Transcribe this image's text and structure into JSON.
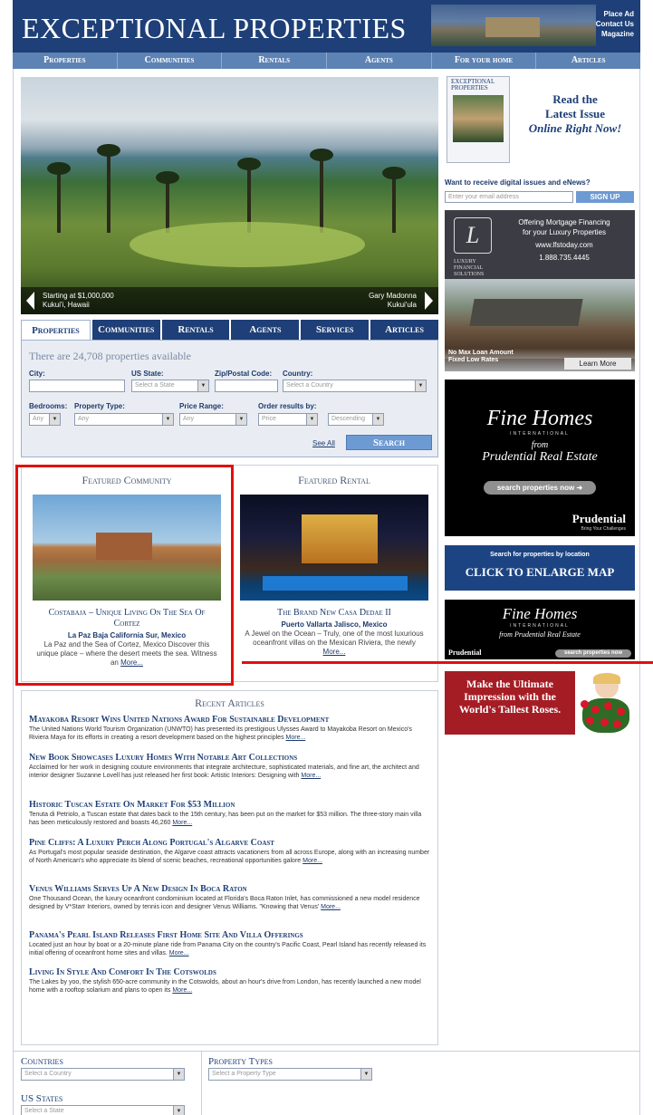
{
  "header": {
    "logo": "EXCEPTIONAL PROPERTIES",
    "links": [
      "Place Ad",
      "Contact Us",
      "Magazine"
    ]
  },
  "topnav": [
    "Properties",
    "Communities",
    "Rentals",
    "Agents",
    "For your home",
    "Articles"
  ],
  "hero": {
    "left_caption_line1": "Starting at $1,000,000",
    "left_caption_line2": "Kukui'i, Hawaii",
    "right_caption_line1": "Gary Madonna",
    "right_caption_line2": "Kukui'ula"
  },
  "search": {
    "tabs": [
      "Properties",
      "Communities",
      "Rentals",
      "Agents",
      "Services",
      "Articles"
    ],
    "count_text": "There are 24,708 properties available",
    "city_label": "City:",
    "state_label": "US State:",
    "state_value": "Select a State",
    "zip_label": "Zip/Postal Code:",
    "country_label": "Country:",
    "country_value": "Select a Country",
    "bedrooms_label": "Bedrooms:",
    "bedrooms_value": "Any",
    "type_label": "Property Type:",
    "type_value": "Any",
    "price_label": "Price Range:",
    "price_value": "Any",
    "order_label": "Order results by:",
    "order_value": "Price",
    "direction_value": "Descending",
    "see_all": "See All",
    "search_button": "Search"
  },
  "featured": {
    "community": {
      "heading": "Featured Community",
      "name": "Costabaja – Unique Living On The Sea Of Cortez",
      "location": "La Paz Baja California Sur, Mexico",
      "description": "La Paz and the Sea of Cortez, Mexico Discover this unique place – where the desert meets the sea. Witness an",
      "more": "More..."
    },
    "rental": {
      "heading": "Featured Rental",
      "name": "The Brand New Casa Dedae II",
      "location": "Puerto Vallarta Jalisco, Mexico",
      "description": "A Jewel on the Ocean – Truly, one of the most luxurious oceanfront villas on the Mexican Riviera, the newly",
      "more": "More..."
    }
  },
  "articles": {
    "heading": "Recent Articles",
    "items": [
      {
        "title": "Mayakoba Resort Wins United Nations Award For Sustainable Development",
        "text": "The United Nations World Tourism Organization (UNWTO) has presented its prestigious Ulysses Award to Mayakoba Resort on Mexico's Riviera Maya for its efforts in creating a resort development based on the highest principles",
        "more": "More..."
      },
      {
        "title": "New Book Showcases Luxury Homes With Notable Art Collections",
        "text": "Acclaimed for her work in designing couture environments that integrate architecture, sophisticated materials, and fine art, the architect and interior designer Suzanne Lovell has just released her first book: Artistic Interiors: Designing with",
        "more": "More..."
      },
      {
        "title": "Historic Tuscan Estate On Market For $53 Million",
        "text": "Tenuta di Petriolo, a Tuscan estate that dates back to the 15th century, has been put on the market for $53 million. The three-story main villa has been meticulously restored and boasts 46,260",
        "more": "More..."
      },
      {
        "title": "Pine Cliffs: A Luxury Perch Along Portugal's Algarve Coast",
        "text": "As Portugal's most popular seaside destination, the Algarve coast attracts vacationers from all across Europe, along with an increasing number of North American's who appreciate its blend of scenic beaches, recreational opportunities galore",
        "more": "More..."
      },
      {
        "title": "Venus Williams Serves Up A New Design In Boca Raton",
        "text": "One Thousand Ocean, the luxury oceanfront condominium located at Florida's Boca Raton Inlet, has commissioned a new model residence designed by V*Starr Interiors, owned by tennis icon and designer Venus Williams. \"Knowing that Venus'",
        "more": "More..."
      },
      {
        "title": "Panama's Pearl Island Releases First Home Site And Villa Offerings",
        "text": "Located just an hour by boat or a 20-minute plane ride from Panama City on the country's Pacific Coast, Pearl Island has recently released its initial offering of oceanfront home sites and villas.",
        "more": "More..."
      },
      {
        "title": "Living In Style And Comfort In The Cotswolds",
        "text": "The Lakes by yoo, the stylish 650-acre community in the Cotswolds, about an hour's drive from London, has recently launched a new model home with a rooftop solarium and plans to open its",
        "more": "More..."
      }
    ]
  },
  "bottom_filters": {
    "countries_label": "Countries",
    "countries_value": "Select a Country",
    "types_label": "Property Types",
    "types_value": "Select a Property Type",
    "states_label": "US States",
    "states_value": "Select a State"
  },
  "sidebar": {
    "magazine": {
      "cover_title": "EXCEPTIONAL PROPERTIES",
      "line1": "Read the",
      "line2": "Latest Issue",
      "line3": "Online Right Now!"
    },
    "enews": {
      "label": "Want to receive digital issues and eNews?",
      "placeholder": "Enter your email address",
      "button": "SIGN UP"
    },
    "mortgage_ad": {
      "logo_letter": "L",
      "logo_text": "LUXURY FINANCIAL SOLUTIONS",
      "line1": "Offering Mortgage Financing",
      "line2": "for your Luxury Properties",
      "url": "www.lfstoday.com",
      "phone": "1.888.735.4445",
      "caption_line1": "No Max Loan Amount",
      "caption_line2": "Fixed Low Rates",
      "learn_more": "Learn More"
    },
    "fine_homes_ad": {
      "title": "Fine Homes",
      "international": "INTERNATIONAL",
      "from": "from",
      "company": "Prudential Real Estate",
      "button": "search properties now",
      "brand": "Prudential",
      "tagline": "Bring Your Challenges"
    },
    "map_ad": {
      "small": "Search for properties by location",
      "big": "CLICK TO ENLARGE MAP"
    },
    "fine_homes_ad2": {
      "title": "Fine Homes",
      "international": "INTERNATIONAL",
      "from_company": "from Prudential Real Estate",
      "brand": "Prudential",
      "button": "search properties now"
    },
    "roses_ad": {
      "line1": "Make the Ultimate",
      "line2": "Impression with the",
      "line3": "World's Tallest Roses."
    }
  },
  "colors": {
    "navy": "#1e3f77",
    "nav_blue": "#5d83b5",
    "button_blue": "#6d9ad2",
    "highlight_red": "#e10f0f",
    "roses_red": "#a51d24"
  }
}
